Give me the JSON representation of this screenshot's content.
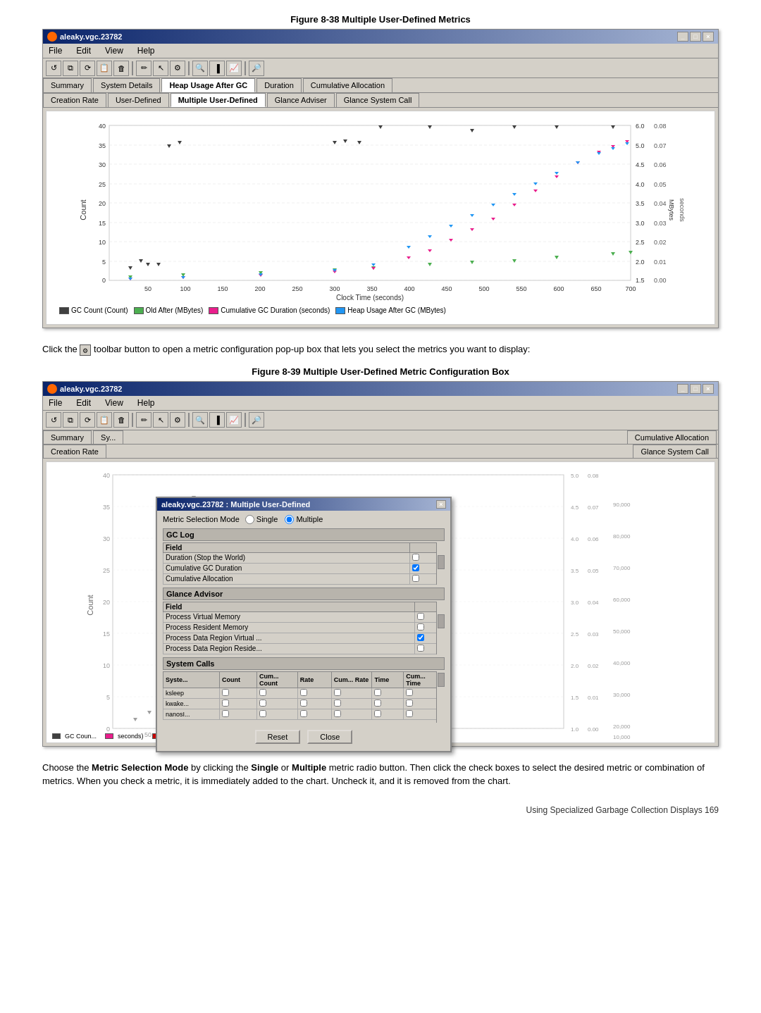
{
  "figure1": {
    "title": "Figure 8-38 Multiple User-Defined Metrics",
    "window_title": "aleaky.vgc.23782",
    "menu": [
      "File",
      "Edit",
      "View",
      "Help"
    ],
    "tabs_row1": [
      "Summary",
      "System Details",
      "Heap Usage After GC",
      "Duration",
      "Cumulative Allocation"
    ],
    "tabs_row2": [
      "Creation Rate",
      "User-Defined",
      "Multiple User-Defined",
      "Glance Adviser",
      "Glance System Call"
    ],
    "active_tab_row1": "Heap Usage After GC",
    "active_tab_row2": "Multiple User-Defined",
    "chart": {
      "x_label": "Clock Time  (seconds)",
      "y_left_label": "Count",
      "y_right_label1": "MBytes",
      "y_right_label2": "seconds",
      "y_left_max": 40,
      "y_right1_max": 6.0,
      "y_right2_max": 0.08,
      "x_ticks": [
        50,
        100,
        150,
        200,
        250,
        300,
        350,
        400,
        450,
        500,
        550,
        600,
        650,
        700
      ]
    },
    "legend": [
      {
        "color": "#404040",
        "label": "GC Count  (Count)"
      },
      {
        "color": "#4caf50",
        "label": "Old After  (MBytes)"
      },
      {
        "color": "#e91e8c",
        "label": "Cumulative GC Duration  (seconds)"
      },
      {
        "color": "#2196f3",
        "label": "Heap Usage After GC  (MBytes)"
      }
    ],
    "controls": [
      "undo",
      "copy",
      "reset",
      "paste",
      "clear",
      "zoom-in",
      "zoom-out",
      "search",
      "bar",
      "line",
      "magnify"
    ]
  },
  "prose1": {
    "text1": "Click the",
    "text2": "toolbar button to open a metric configuration pop-up box that lets you select the metrics you want to display:"
  },
  "figure2": {
    "title": "Figure 8-39 Multiple User-Defined Metric Configuration Box",
    "window_title": "aleaky.vgc.23782",
    "menu": [
      "File",
      "Edit",
      "View",
      "Help"
    ],
    "tabs_row1_partial": [
      "Summary",
      "Sy..."
    ],
    "tabs_row2_partial": [
      "Creation Rate"
    ],
    "dialog": {
      "title": "aleaky.vgc.23782 : Multiple User-Defined",
      "mode_label": "Metric Selection Mode",
      "mode_single": "Single",
      "mode_multiple": "Multiple",
      "mode_selected": "multiple",
      "gc_log_section": "GC Log",
      "gc_log_field_header": "Field",
      "gc_log_fields": [
        {
          "name": "Duration (Stop the World)",
          "checked": false
        },
        {
          "name": "Cumulative GC Duration",
          "checked": true
        },
        {
          "name": "Cumulative Allocation",
          "checked": false
        }
      ],
      "glance_advisor_section": "Glance Advisor",
      "glance_fields_header": "Field",
      "glance_fields": [
        {
          "name": "Process Virtual Memory",
          "checked": false
        },
        {
          "name": "Process Resident Memory",
          "checked": false
        },
        {
          "name": "Process Data Region Virtual ...",
          "checked": true
        },
        {
          "name": "Process Data Region Reside...",
          "checked": false
        }
      ],
      "syscalls_section": "System Calls",
      "syscall_headers": [
        "Syste...",
        "Count",
        "Cum... Count",
        "Rate",
        "Cum... Rate",
        "Time",
        "Cum... Time"
      ],
      "syscall_rows": [
        {
          "name": "ksleep",
          "cols": [
            false,
            false,
            false,
            false,
            false,
            false
          ]
        },
        {
          "name": "kwake...",
          "cols": [
            false,
            false,
            false,
            false,
            false,
            false
          ]
        },
        {
          "name": "nanosI...",
          "cols": [
            false,
            false,
            false,
            false,
            false,
            false
          ]
        }
      ],
      "btn_reset": "Reset",
      "btn_close": "Close"
    },
    "right_panel": {
      "tab_cumulative": "Cumulative Allocation",
      "tab_glance": "Glance System Call"
    }
  },
  "prose2": {
    "text": "Choose the Metric Selection Mode by clicking the Single or Multiple metric radio button. Then click the check boxes to select the desired metric or combination of metrics. When you check a metric, it is immediately added to the chart. Uncheck it, and it is removed from the chart."
  },
  "footer": {
    "text": "Using Specialized Garbage Collection Displays    169"
  }
}
